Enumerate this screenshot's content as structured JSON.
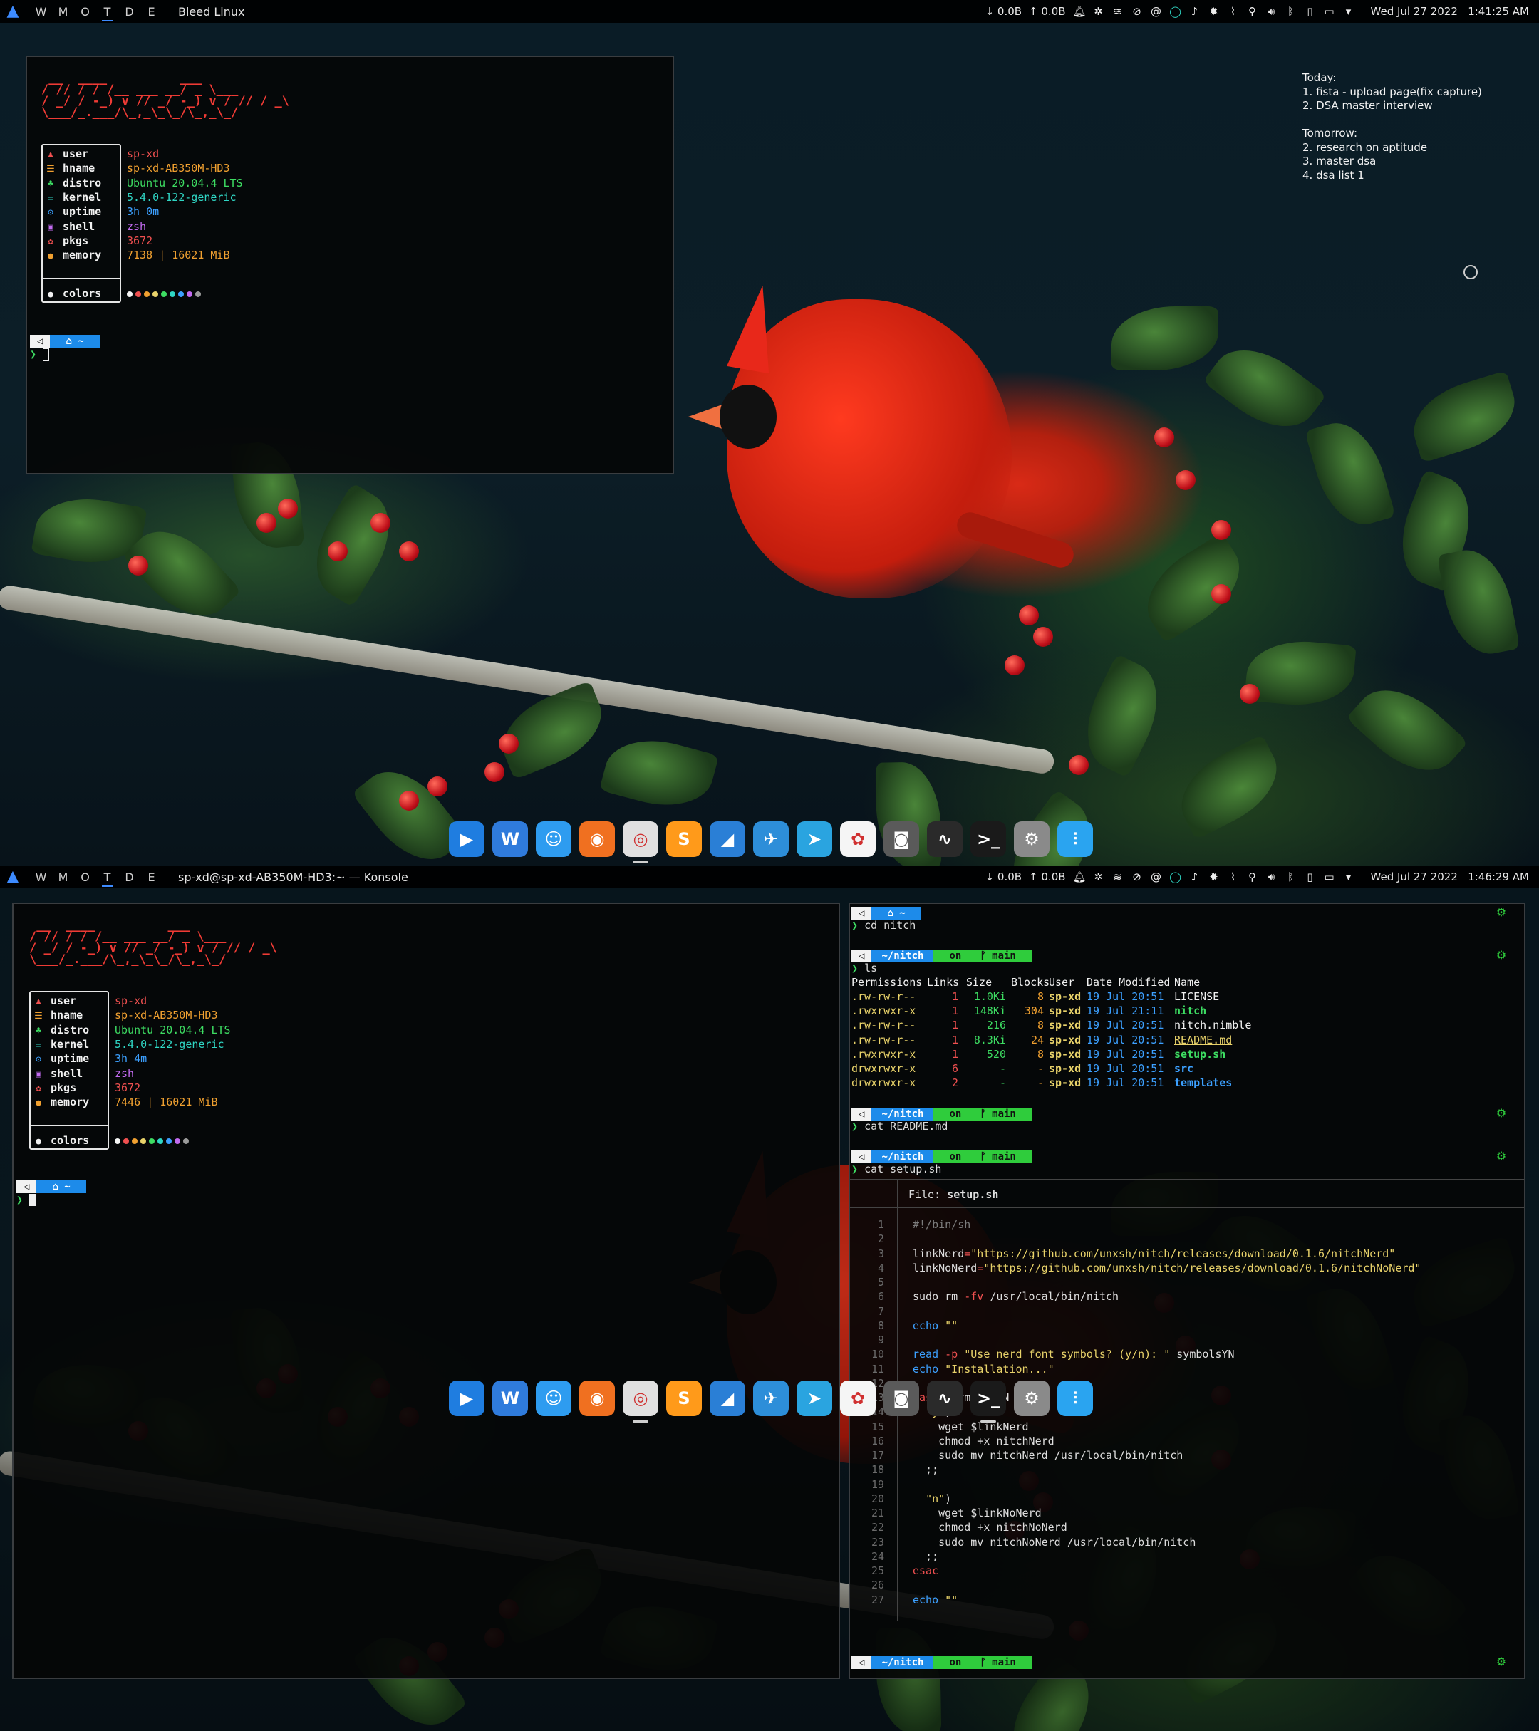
{
  "os_name": "Bleed Linux",
  "workspaces": [
    "W",
    "M",
    "O",
    "T",
    "D",
    "E"
  ],
  "active_workspace": "T",
  "screens": [
    {
      "window_title": "Bleed Linux",
      "net_down": "0.0B",
      "net_up": "0.0B",
      "datetime": "Wed Jul 27 2022   1:41:25 AM"
    },
    {
      "window_title": "sp-xd@sp-xd-AB350M-HD3:~ — Konsole",
      "net_down": "0.0B",
      "net_up": "0.0B",
      "datetime": "Wed Jul 27 2022   1:46:29 AM"
    }
  ],
  "tray_icons": [
    "bell-icon",
    "compass-icon",
    "flame-icon",
    "dnd-icon",
    "at-icon",
    "ring-icon",
    "music-icon",
    "gear-icon",
    "paperclip-icon",
    "location-icon",
    "volume-icon",
    "bluetooth-icon",
    "battery-icon",
    "screen-icon",
    "chevron-down-icon"
  ],
  "todo": "Today:\n1. fista - upload page(fix capture)\n2. DSA master interview\n\nTomorrow:\n2. research on aptitude\n3. master dsa\n4. dsa list 1",
  "ascii_logo": " __  ____          ___\n/ // / / /__ ___ __/ _ \\___\n/ _/ / -_) v // _/ -_) v / // / _\\\n\\___/_.___/\\_,_\\_\\_/\\_,_\\_/",
  "fetch": {
    "rows_1": [
      {
        "icon": "user-icon",
        "icon_char": "♟",
        "icon_color": "#f05050",
        "key": "user",
        "value": "sp-xd",
        "color": "#f05050"
      },
      {
        "icon": "hname-icon",
        "icon_char": "☰",
        "icon_color": "#f0a030",
        "key": "hname",
        "value": "sp-xd-AB350M-HD3",
        "color": "#f0a030"
      },
      {
        "icon": "distro-icon",
        "icon_char": "♣",
        "icon_color": "#3ddc62",
        "key": "distro",
        "value": "Ubuntu 20.04.4 LTS",
        "color": "#3ddc62"
      },
      {
        "icon": "kernel-icon",
        "icon_char": "▭",
        "icon_color": "#2fd6c4",
        "key": "kernel",
        "value": "5.4.0-122-generic",
        "color": "#2fd6c4"
      },
      {
        "icon": "uptime-icon",
        "icon_char": "⊙",
        "icon_color": "#3ca0ff",
        "key": "uptime",
        "value": "3h 0m",
        "color": "#3ca0ff"
      },
      {
        "icon": "shell-icon",
        "icon_char": "▣",
        "icon_color": "#c26bf0",
        "key": "shell",
        "value": "zsh",
        "color": "#c26bf0"
      },
      {
        "icon": "pkgs-icon",
        "icon_char": "✿",
        "icon_color": "#f05050",
        "key": "pkgs",
        "value": "3672",
        "color": "#f05050"
      },
      {
        "icon": "memory-icon",
        "icon_char": "●",
        "icon_color": "#f0a030",
        "key": "memory",
        "value": "7138 | 16021 MiB",
        "color": "#f0a030"
      }
    ],
    "rows_2": [
      {
        "icon": "user-icon",
        "icon_char": "♟",
        "icon_color": "#f05050",
        "key": "user",
        "value": "sp-xd",
        "color": "#f05050"
      },
      {
        "icon": "hname-icon",
        "icon_char": "☰",
        "icon_color": "#f0a030",
        "key": "hname",
        "value": "sp-xd-AB350M-HD3",
        "color": "#f0a030"
      },
      {
        "icon": "distro-icon",
        "icon_char": "♣",
        "icon_color": "#3ddc62",
        "key": "distro",
        "value": "Ubuntu 20.04.4 LTS",
        "color": "#3ddc62"
      },
      {
        "icon": "kernel-icon",
        "icon_char": "▭",
        "icon_color": "#2fd6c4",
        "key": "kernel",
        "value": "5.4.0-122-generic",
        "color": "#2fd6c4"
      },
      {
        "icon": "uptime-icon",
        "icon_char": "⊙",
        "icon_color": "#3ca0ff",
        "key": "uptime",
        "value": "3h 4m",
        "color": "#3ca0ff"
      },
      {
        "icon": "shell-icon",
        "icon_char": "▣",
        "icon_color": "#c26bf0",
        "key": "shell",
        "value": "zsh",
        "color": "#c26bf0"
      },
      {
        "icon": "pkgs-icon",
        "icon_char": "✿",
        "icon_color": "#f05050",
        "key": "pkgs",
        "value": "3672",
        "color": "#f05050"
      },
      {
        "icon": "memory-icon",
        "icon_char": "●",
        "icon_color": "#f0a030",
        "key": "memory",
        "value": "7446 | 16021 MiB",
        "color": "#f0a030"
      }
    ],
    "colors_label": "colors",
    "palette": [
      "#f5f5f5",
      "#f05050",
      "#f0a030",
      "#e8d26a",
      "#3ddc62",
      "#2fd6c4",
      "#3ca0ff",
      "#c26bf0",
      "#9a9a9a"
    ]
  },
  "prompt": {
    "home": "~",
    "dir": "~/nitch",
    "git": "on",
    "branch": "main"
  },
  "commands": [
    "cd nitch",
    "ls",
    "cat README.md",
    "cat setup.sh"
  ],
  "ls": {
    "headers": [
      "Permissions",
      "Links",
      "Size",
      "Blocks",
      "User",
      "Date Modified",
      "Name"
    ],
    "rows": [
      [
        ".rw-rw-r--",
        "1",
        "1.0Ki",
        "8",
        "sp-xd",
        "19 Jul 20:51",
        "LICENSE"
      ],
      [
        ".rwxrwxr-x",
        "1",
        "148Ki",
        "304",
        "sp-xd",
        "19 Jul 21:11",
        "nitch"
      ],
      [
        ".rw-rw-r--",
        "1",
        "216",
        "8",
        "sp-xd",
        "19 Jul 20:51",
        "nitch.nimble"
      ],
      [
        ".rw-rw-r--",
        "1",
        "8.3Ki",
        "24",
        "sp-xd",
        "19 Jul 20:51",
        "README.md"
      ],
      [
        ".rwxrwxr-x",
        "1",
        "520",
        "8",
        "sp-xd",
        "19 Jul 20:51",
        "setup.sh"
      ],
      [
        "drwxrwxr-x",
        "6",
        "-",
        "-",
        "sp-xd",
        "19 Jul 20:51",
        "src"
      ],
      [
        "drwxrwxr-x",
        "2",
        "-",
        "-",
        "sp-xd",
        "19 Jul 20:51",
        "templates"
      ]
    ]
  },
  "file_label": "File:",
  "file_name": "setup.sh",
  "code": [
    "#!/bin/sh",
    "",
    "linkNerd=\"https://github.com/unxsh/nitch/releases/download/0.1.6/nitchNerd\"",
    "linkNoNerd=\"https://github.com/unxsh/nitch/releases/download/0.1.6/nitchNoNerd\"",
    "",
    "sudo rm -fv /usr/local/bin/nitch",
    "",
    "echo \"\"",
    "",
    "read -p \"Use nerd font symbols? (y/n): \" symbolsYN",
    "echo \"Installation...\"",
    "",
    "case $symbolsYN in",
    "  \"y\")",
    "    wget $linkNerd",
    "    chmod +x nitchNerd",
    "    sudo mv nitchNerd /usr/local/bin/nitch",
    "  ;;",
    "",
    "  \"n\")",
    "    wget $linkNoNerd",
    "    chmod +x nitchNoNerd",
    "    sudo mv nitchNoNerd /usr/local/bin/nitch",
    "  ;;",
    "esac",
    "",
    "echo \"\""
  ],
  "dock": [
    {
      "name": "media-player-icon",
      "glyph": "▶",
      "bg": "#1f7de0"
    },
    {
      "name": "writer-icon",
      "glyph": "W",
      "bg": "#2f7bdc"
    },
    {
      "name": "finder-icon",
      "glyph": "☺",
      "bg": "#2e9cf0"
    },
    {
      "name": "firefox-icon",
      "glyph": "◉",
      "bg": "#f07020"
    },
    {
      "name": "chrome-icon",
      "glyph": "◎",
      "bg": "#e0e0e0"
    },
    {
      "name": "sublime-icon",
      "glyph": "S",
      "bg": "#ff9a1a"
    },
    {
      "name": "vscode-icon",
      "glyph": "◢",
      "bg": "#2a7fd6"
    },
    {
      "name": "swift-icon",
      "glyph": "✈",
      "bg": "#2d8ed9"
    },
    {
      "name": "telegram-icon",
      "glyph": "➤",
      "bg": "#2aa4e0"
    },
    {
      "name": "photos-icon",
      "glyph": "✿",
      "bg": "#f5f5f5"
    },
    {
      "name": "screenshot-icon",
      "glyph": "◙",
      "bg": "#5a5a5a"
    },
    {
      "name": "monitor-icon",
      "glyph": "∿",
      "bg": "#2a2a2a"
    },
    {
      "name": "terminal-icon",
      "glyph": ">_",
      "bg": "#1a1a1a"
    },
    {
      "name": "settings-icon",
      "glyph": "⚙",
      "bg": "#8a8a8a"
    },
    {
      "name": "equalizer-icon",
      "glyph": "⫶",
      "bg": "#2aa4f0"
    }
  ],
  "dock_running": {
    "screen1": [
      "chrome-icon"
    ],
    "screen2": [
      "chrome-icon",
      "terminal-icon"
    ]
  }
}
